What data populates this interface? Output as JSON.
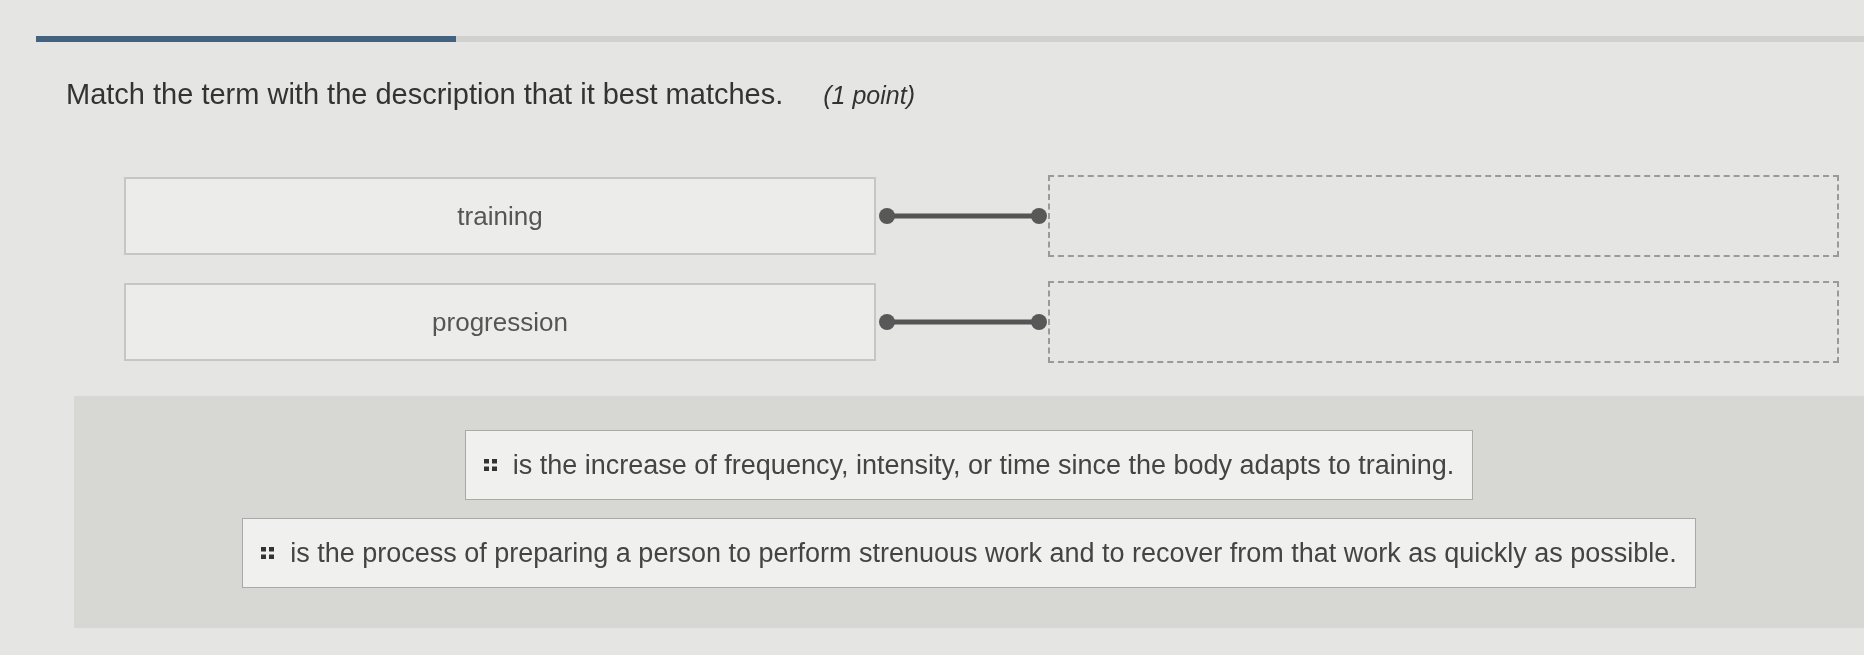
{
  "progress": {
    "level": 0.23
  },
  "question": {
    "text": "Match the term with the description that it best matches.",
    "points": "(1 point)"
  },
  "pairs": [
    {
      "term": "training"
    },
    {
      "term": "progression"
    }
  ],
  "answers": [
    {
      "text": "is the increase of frequency, intensity, or time since the body adapts to training."
    },
    {
      "text": "is the process of preparing a person to perform strenuous work and to recover from that work as quickly as possible."
    }
  ]
}
